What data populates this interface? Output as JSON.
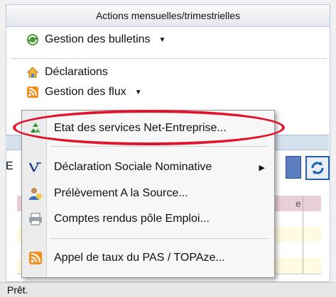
{
  "panel": {
    "header": "Actions mensuelles/trimestrielles",
    "items": [
      {
        "label": "Gestion des bulletins",
        "icon": "refresh-globe-icon",
        "has_dropdown": true
      },
      {
        "label": "Déclarations",
        "icon": "house-icon",
        "has_dropdown": false
      },
      {
        "label": "Gestion des flux",
        "icon": "rss-icon",
        "has_dropdown": true
      }
    ]
  },
  "partial_letter": "E",
  "grid": {
    "header_fragment": "e"
  },
  "context_menu": {
    "items": [
      {
        "label": "Etat des services Net-Entreprise...",
        "icon": "recycle-icon",
        "submenu": false,
        "highlighted": true
      },
      {
        "label": "Déclaration Sociale Nominative",
        "icon": "dsn-icon",
        "submenu": true
      },
      {
        "label": "Prélèvement A la Source...",
        "icon": "person-icon",
        "submenu": false
      },
      {
        "label": "Comptes rendus pôle Emploi...",
        "icon": "printer-icon",
        "submenu": false
      },
      {
        "label": "Appel de taux du PAS / TOPAze...",
        "icon": "rss-icon",
        "submenu": false
      }
    ]
  },
  "status_bar": {
    "text": "Prêt."
  },
  "colors": {
    "highlight_circle": "#e0142b",
    "grid_header": "#e9cfd8",
    "grid_alt_row": "#fffbe3"
  }
}
